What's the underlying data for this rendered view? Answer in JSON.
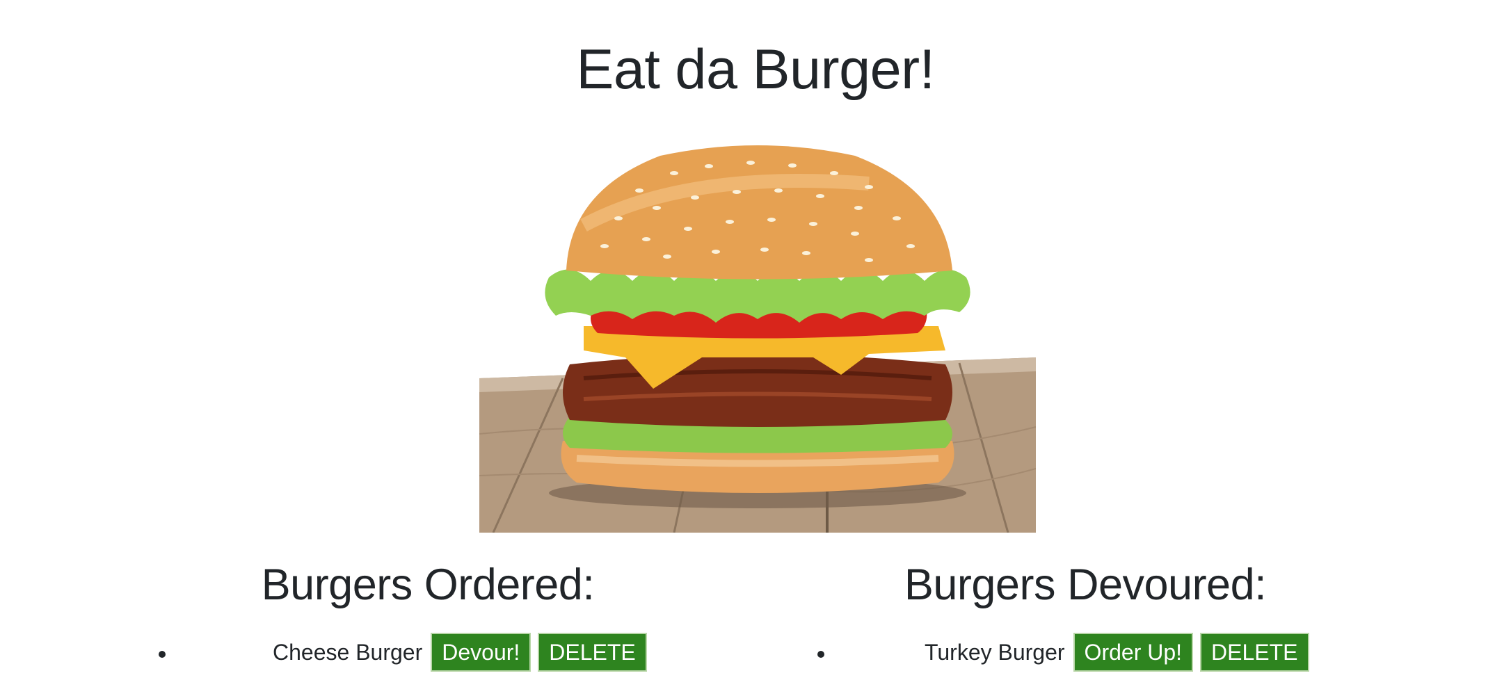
{
  "header": {
    "title": "Eat da Burger!"
  },
  "hero_image": {
    "icon": "burger-photo"
  },
  "ordered": {
    "heading": "Burgers Ordered:",
    "items": [
      {
        "name": "Cheese Burger",
        "primary_action": "Devour!",
        "delete_action": "DELETE"
      }
    ]
  },
  "devoured": {
    "heading": "Burgers Devoured:",
    "items": [
      {
        "name": "Turkey Burger",
        "primary_action": "Order Up!",
        "delete_action": "DELETE"
      }
    ]
  },
  "colors": {
    "button_bg": "#2e841f",
    "button_border": "#b9d6a8",
    "text": "#212529"
  }
}
